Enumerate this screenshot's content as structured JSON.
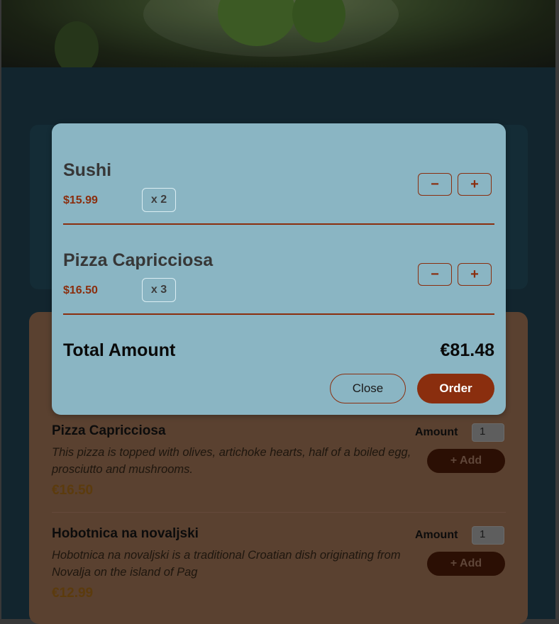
{
  "cart": {
    "items": [
      {
        "name": "Sushi",
        "price": "$15.99",
        "quantity": "x 2",
        "minus": "−",
        "plus": "+"
      },
      {
        "name": "Pizza Capricciosa",
        "price": "$16.50",
        "quantity": "x 3",
        "minus": "−",
        "plus": "+"
      }
    ],
    "total_label": "Total Amount",
    "total_value": "€81.48",
    "close_label": "Close",
    "order_label": "Order"
  },
  "meals": [
    {
      "name": "Pizza Capricciosa",
      "description": "This pizza is topped with olives, artichoke hearts, half of a boiled egg, prosciutto and mushrooms.",
      "price": "€16.50",
      "amount_label": "Amount",
      "amount_value": "1",
      "add_label": "+ Add"
    },
    {
      "name": "Hobotnica na novaljski",
      "description": "Hobotnica na novaljski is a traditional Croatian dish originating from Novalja on the island of Pag",
      "price": "€12.99",
      "amount_label": "Amount",
      "amount_value": "1",
      "add_label": "+ Add"
    }
  ],
  "colors": {
    "modal_bg": "#8ab5c3",
    "accent": "#8a2e0e",
    "page_bg": "#12252e",
    "meals_card_bg": "#5a4130"
  }
}
